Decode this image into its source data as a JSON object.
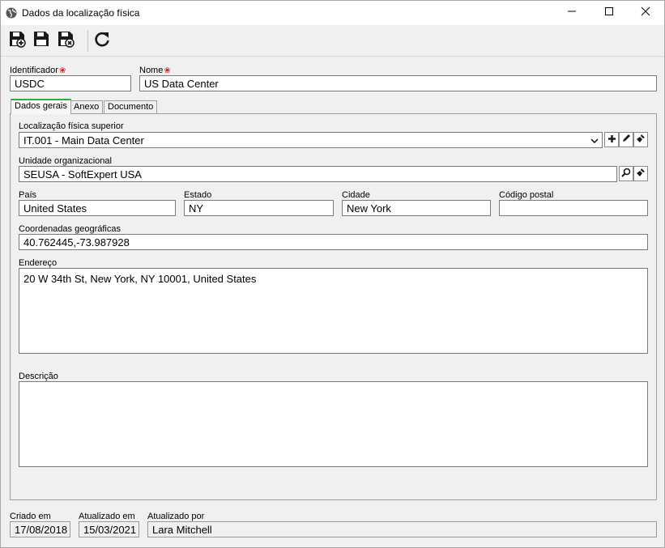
{
  "window": {
    "title": "Dados da localização física"
  },
  "toolbar": {
    "buttons": [
      "save-new-icon",
      "save-icon",
      "save-close-icon",
      "refresh-icon"
    ]
  },
  "header": {
    "identificador": {
      "label": "Identificador",
      "value": "USDC"
    },
    "nome": {
      "label": "Nome",
      "value": "US Data Center"
    }
  },
  "tabs": [
    {
      "label": "Dados gerais",
      "active": true
    },
    {
      "label": "Anexo",
      "active": false
    },
    {
      "label": "Documento",
      "active": false
    }
  ],
  "general": {
    "localizacao_superior": {
      "label": "Localização física superior",
      "value": "IT.001 - Main Data Center"
    },
    "unidade": {
      "label": "Unidade organizacional",
      "value": "SEUSA - SoftExpert USA"
    },
    "pais": {
      "label": "País",
      "value": "United States"
    },
    "estado": {
      "label": "Estado",
      "value": "NY"
    },
    "cidade": {
      "label": "Cidade",
      "value": "New York"
    },
    "codigo_postal": {
      "label": "Código postal",
      "value": ""
    },
    "coordenadas": {
      "label": "Coordenadas geográficas",
      "value": "40.762445,-73.987928"
    },
    "endereco": {
      "label": "Endereço",
      "value": "20 W 34th St, New York, NY 10001, United States"
    },
    "descricao": {
      "label": "Descrição",
      "value": ""
    }
  },
  "footer": {
    "criado_em": {
      "label": "Criado em",
      "value": "17/08/2018"
    },
    "atualizado_em": {
      "label": "Atualizado em",
      "value": "15/03/2021"
    },
    "atualizado_por": {
      "label": "Atualizado por",
      "value": "Lara Mitchell"
    }
  },
  "colors": {
    "required": "#d9251c",
    "active_tab": "#2fae3b"
  }
}
